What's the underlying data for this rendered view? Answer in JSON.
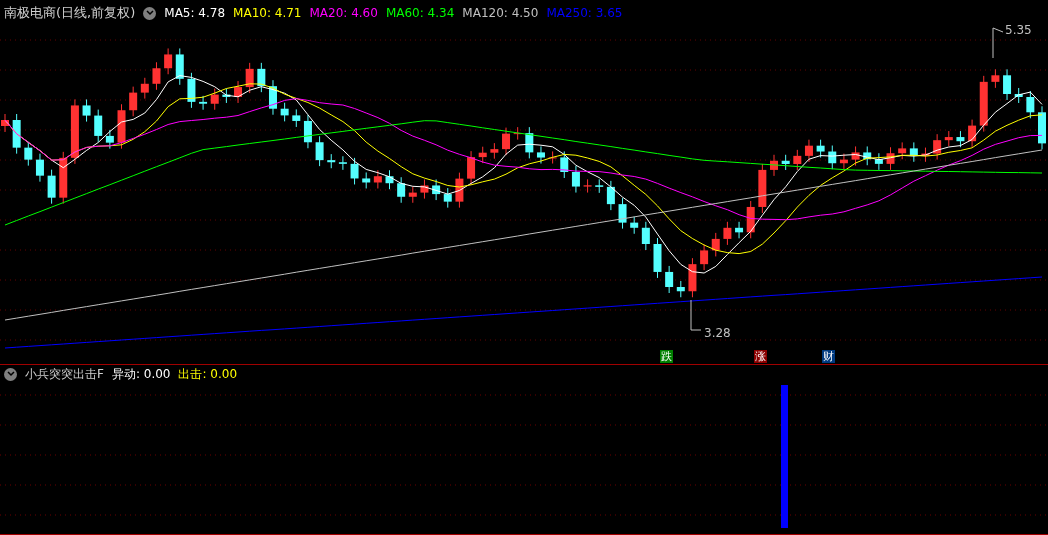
{
  "chart": {
    "title": "南极电商(日线,前复权)",
    "indicators": [
      {
        "label": "MA5: 4.78",
        "color": "#ffffff"
      },
      {
        "label": "MA10: 4.71",
        "color": "#ffff00"
      },
      {
        "label": "MA20: 4.60",
        "color": "#ff00ff"
      },
      {
        "label": "MA60: 4.34",
        "color": "#00ff00"
      },
      {
        "label": "MA120: 4.50",
        "color": "#c0c0c0"
      },
      {
        "label": "MA250: 3.65",
        "color": "#0000ff"
      }
    ],
    "high_label": "5.35",
    "low_label": "3.28",
    "markers": [
      {
        "text": "跌",
        "color": "#008000"
      },
      {
        "text": "涨",
        "color": "#8b0000"
      },
      {
        "text": "财",
        "color": "#003a80"
      }
    ]
  },
  "sub_panel": {
    "title": "小兵突突出击F",
    "values": [
      {
        "label": "异动: 0.00",
        "color": "#ffffff"
      },
      {
        "label": "出击: 0.00",
        "color": "#ffff00"
      }
    ]
  }
}
